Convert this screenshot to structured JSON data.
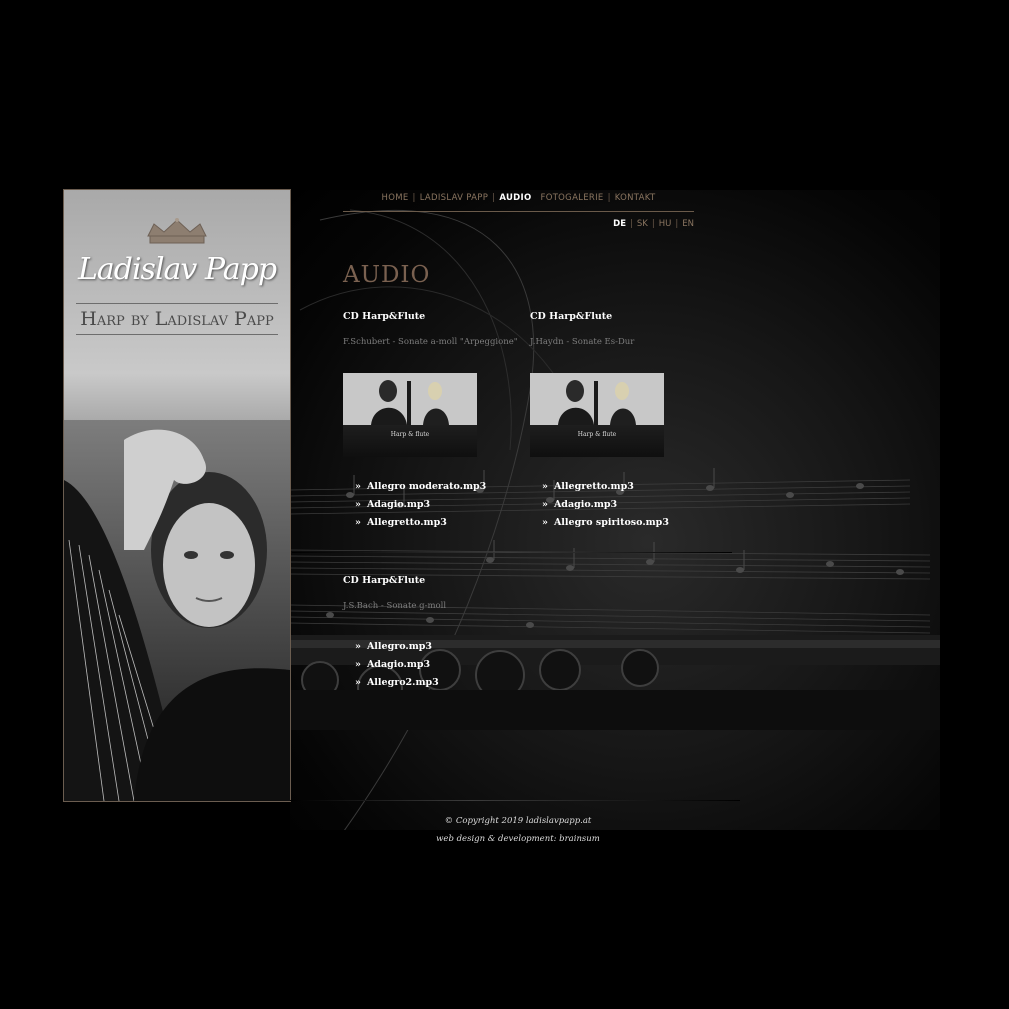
{
  "nav": {
    "items": [
      "HOME",
      "LADISLAV PAPP",
      "AUDIO",
      "FOTOGALERIE",
      "KONTAKT"
    ],
    "active": "AUDIO",
    "separator": "|"
  },
  "langs": {
    "items": [
      "DE",
      "SK",
      "HU",
      "EN"
    ],
    "active": "DE"
  },
  "logo": {
    "script": "Ladislav Papp",
    "subtitle": "Harp by Ladislav Papp"
  },
  "page_title": "AUDIO",
  "albums": [
    {
      "title": "CD Harp&Flute",
      "subtitle": "F.Schubert - Sonate a-moll \"Arpeggione\"",
      "cover_text": "Harp & flute",
      "tracks": [
        "Allegro moderato.mp3",
        "Adagio.mp3",
        "Allegretto.mp3"
      ]
    },
    {
      "title": "CD Harp&Flute",
      "subtitle": "J.Haydn - Sonate Es-Dur",
      "cover_text": "Harp & flute",
      "tracks": [
        "Allegretto.mp3",
        "Adagio.mp3",
        "Allegro spiritoso.mp3"
      ]
    },
    {
      "title": "CD Harp&Flute",
      "subtitle": "J.S.Bach - Sonate g-moll",
      "tracks": [
        "Allegro.mp3",
        "Adagio.mp3",
        "Allegro2.mp3"
      ]
    }
  ],
  "bullet": "»",
  "footer": {
    "copyright": "© Copyright 2019 ladislavpapp.at",
    "credits": "web design & development: brainsum"
  },
  "colors": {
    "accent": "#7a6150",
    "nav_text": "#8a7560",
    "background": "#000000"
  }
}
